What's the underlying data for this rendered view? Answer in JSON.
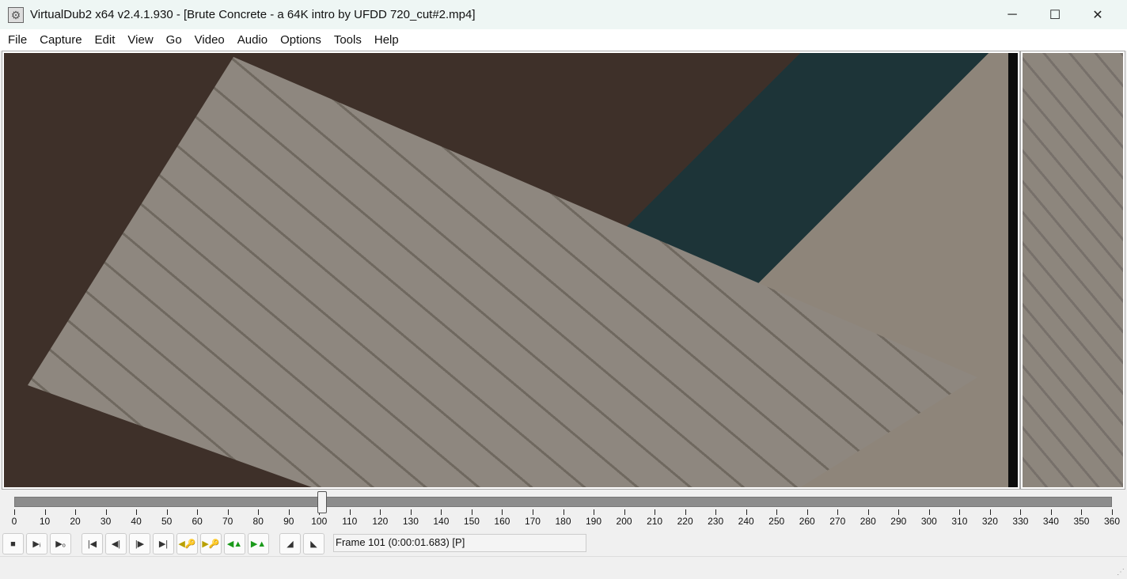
{
  "window": {
    "title": "VirtualDub2 x64 v2.4.1.930 - [Brute Concrete - a 64K intro by UFDD 720_cut#2.mp4]",
    "minimize": "─",
    "maximize": "☐",
    "close": "✕"
  },
  "menu": [
    "File",
    "Capture",
    "Edit",
    "View",
    "Go",
    "Video",
    "Audio",
    "Options",
    "Tools",
    "Help"
  ],
  "timeline": {
    "min": 0,
    "max": 360,
    "step": 10,
    "position": 101
  },
  "toolbar": [
    {
      "name": "stop-button",
      "glyph": "■"
    },
    {
      "name": "play-input-button",
      "glyph": "▶ᵢ"
    },
    {
      "name": "play-output-button",
      "glyph": "▶ₒ"
    },
    {
      "name": "go-start-button",
      "glyph": "|◀"
    },
    {
      "name": "prev-frame-button",
      "glyph": "◀|"
    },
    {
      "name": "next-frame-button",
      "glyph": "|▶"
    },
    {
      "name": "go-end-button",
      "glyph": "▶|"
    },
    {
      "name": "prev-keyframe-button",
      "glyph": "◀🔑"
    },
    {
      "name": "next-keyframe-button",
      "glyph": "▶🔑"
    },
    {
      "name": "prev-scene-button",
      "glyph": "◀▲"
    },
    {
      "name": "next-scene-button",
      "glyph": "▶▲"
    },
    {
      "name": "mark-in-button",
      "glyph": "◢"
    },
    {
      "name": "mark-out-button",
      "glyph": "◣"
    }
  ],
  "status": "Frame 101 (0:00:01.683) [P]"
}
